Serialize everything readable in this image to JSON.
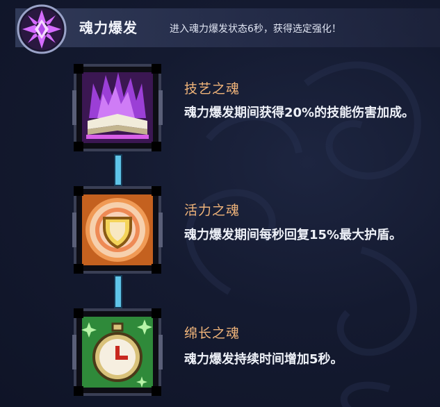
{
  "header": {
    "title": "魂力爆发",
    "description": "进入魂力爆发状态6秒，获得选定强化！"
  },
  "skills": [
    {
      "name": "技艺之魂",
      "description": "魂力爆发期间获得20%的技能伤害加成。",
      "icon": "purple-flame-book-icon"
    },
    {
      "name": "活力之魂",
      "description": "魂力爆发期间每秒回复15%最大护盾。",
      "icon": "orange-shield-icon"
    },
    {
      "name": "绵长之魂",
      "description": "魂力爆发持续时间增加5秒。",
      "icon": "green-stopwatch-icon"
    }
  ],
  "colors": {
    "skill_name": "#f0b47a",
    "connector": "#5fc4e8",
    "accent_purple": "#c85cf0",
    "accent_orange": "#f29a3a",
    "accent_green": "#4cd66a"
  }
}
